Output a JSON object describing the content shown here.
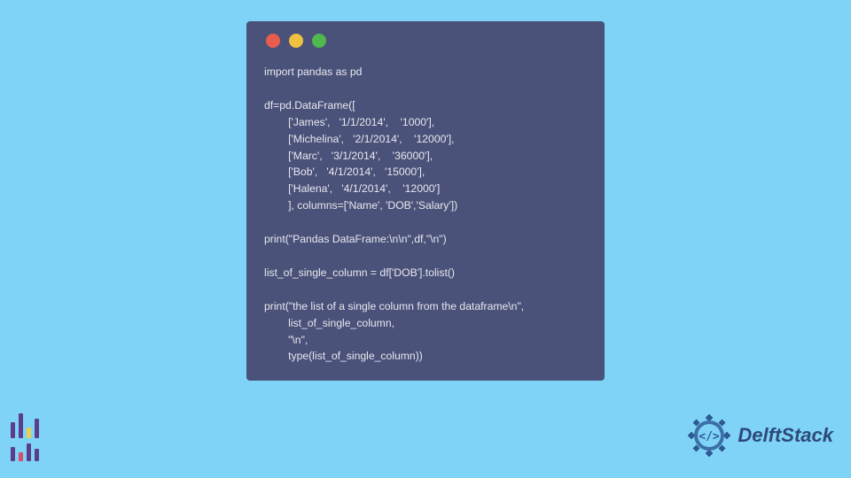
{
  "code": {
    "lines": [
      "import pandas as pd",
      "",
      "df=pd.DataFrame([",
      "        ['James',   '1/1/2014',    '1000'],",
      "        ['Michelina',   '2/1/2014',    '12000'],",
      "        ['Marc',   '3/1/2014',    '36000'],",
      "        ['Bob',   '4/1/2014',   '15000'],",
      "        ['Halena',   '4/1/2014',    '12000']",
      "        ], columns=['Name', 'DOB','Salary'])",
      "",
      "print(\"Pandas DataFrame:\\n\\n\",df,\"\\n\")",
      "",
      "list_of_single_column = df['DOB'].tolist()",
      "",
      "print(\"the list of a single column from the dataframe\\n\",",
      "        list_of_single_column,",
      "        \"\\n\",",
      "        type(list_of_single_column))"
    ]
  },
  "brand": {
    "name": "DelftStack"
  },
  "colors": {
    "background": "#7fd3f7",
    "window": "#4a5279",
    "code_text": "#e8e8f0",
    "dot_red": "#e85d4e",
    "dot_yellow": "#f0c040",
    "dot_green": "#4fb84f",
    "brand_text": "#2d4a7a"
  }
}
